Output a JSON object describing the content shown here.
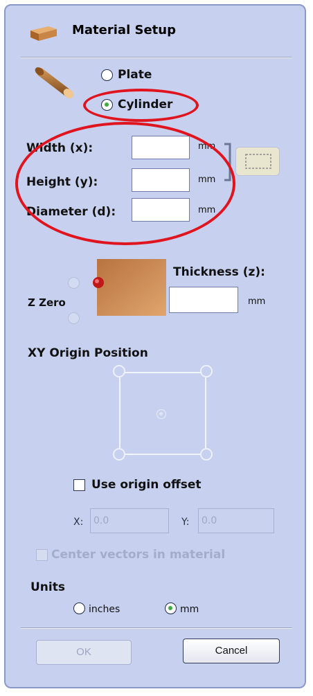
{
  "dialog": {
    "title": "Material Setup"
  },
  "material_type": {
    "plate_label": "Plate",
    "cylinder_label": "Cylinder",
    "selected": "cylinder"
  },
  "dimensions": {
    "width_label": "Width (x):",
    "height_label": "Height (y):",
    "diameter_label": "Diameter (d):",
    "width_value": "",
    "height_value": "",
    "diameter_value": "",
    "unit": "mm"
  },
  "zzero": {
    "label": "Z Zero",
    "thickness_label": "Thickness (z):",
    "thickness_value": "",
    "unit": "mm"
  },
  "xy_origin": {
    "label": "XY Origin Position"
  },
  "origin_offset": {
    "label": "Use origin offset",
    "checked": false,
    "x_label": "X:",
    "x_value": "0.0",
    "y_label": "Y:",
    "y_value": "0.0"
  },
  "center_vectors": {
    "label": "Center vectors in material",
    "checked": false
  },
  "units": {
    "label": "Units",
    "inches_label": "inches",
    "mm_label": "mm",
    "selected": "mm"
  },
  "buttons": {
    "ok_label": "OK",
    "cancel_label": "Cancel"
  },
  "colors": {
    "panel_background": "#c7d1ef",
    "annotation_red": "#e0141e",
    "selected_radio_dot": "#3fae3f"
  },
  "icons": {
    "title_icon": "material-block-icon",
    "cylinder_icon": "cylinder-icon",
    "link_icon": "dimension-link-icon",
    "block_preview": "material-block-preview-icon"
  }
}
